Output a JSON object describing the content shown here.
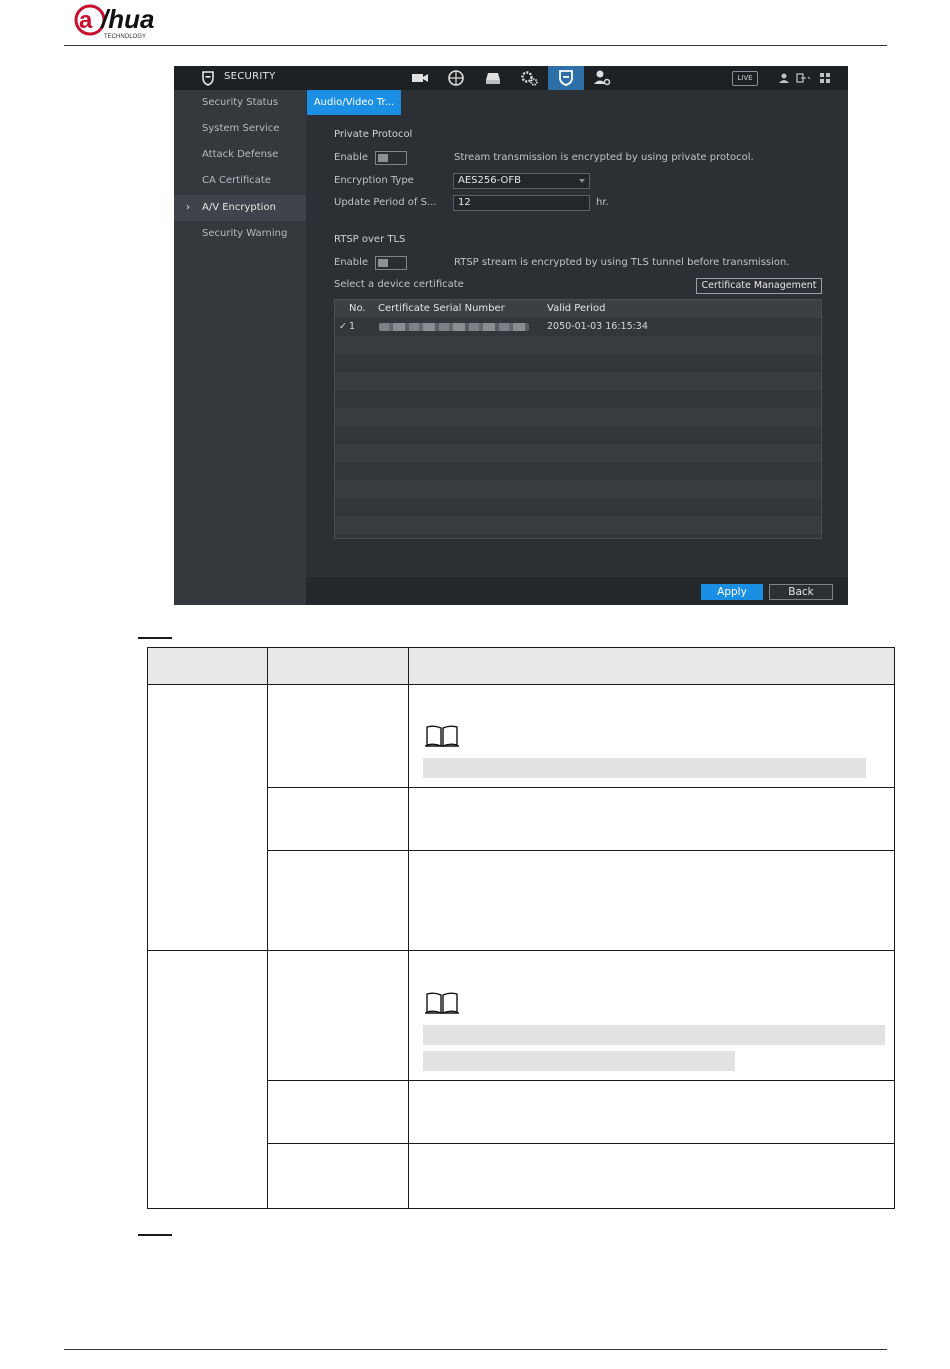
{
  "brand": {
    "logo_text": "alhua",
    "logo_sub": "TECHNOLOGY",
    "brand_color": "#c8102e"
  },
  "ui": {
    "header_title": "SECURITY",
    "toolbar_icons": [
      "camera-icon",
      "network-icon",
      "storage-icon",
      "settings-icon",
      "security-shield-icon",
      "account-icon"
    ],
    "live_label": "LIVE",
    "sidebar": [
      {
        "label": "Security Status"
      },
      {
        "label": "System Service"
      },
      {
        "label": "Attack Defense"
      },
      {
        "label": "CA Certificate"
      },
      {
        "label": "A/V Encryption",
        "active": true
      },
      {
        "label": "Security Warning"
      }
    ],
    "active_tab": "Audio/Video Tr...",
    "private_protocol": {
      "section_title": "Private Protocol",
      "enable_label": "Enable",
      "enable_desc": "Stream transmission is encrypted by using private protocol.",
      "encryption_type_label": "Encryption Type",
      "encryption_type_value": "AES256-OFB",
      "update_period_label": "Update Period of S...",
      "update_period_value": "12",
      "update_period_unit": "hr."
    },
    "rtsp": {
      "section_title": "RTSP over TLS",
      "enable_label": "Enable",
      "enable_desc": "RTSP stream is encrypted by using TLS tunnel before transmission.",
      "select_cert_label": "Select a device certificate",
      "cert_mgmt_button": "Certificate Management"
    },
    "cert_table": {
      "columns": [
        "No.",
        "Certificate Serial Number",
        "Valid Period"
      ],
      "rows": [
        {
          "check": "✓",
          "no": "1",
          "valid_period": "2050-01-03 16:15:34"
        }
      ]
    },
    "apply_button": "Apply",
    "back_button": "Back",
    "accent_color": "#1a8fe3"
  }
}
